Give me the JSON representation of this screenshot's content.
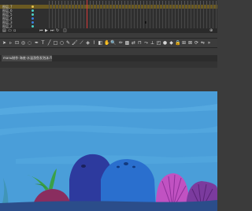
{
  "timeline": {
    "layers": [
      {
        "name": "图层_7",
        "highlight": true,
        "color": "#e6c24d"
      },
      {
        "name": "图层_6",
        "highlight": false,
        "color": "#4bd3c8"
      },
      {
        "name": "图层_5",
        "highlight": false,
        "color": "#4bd3c8"
      },
      {
        "name": "图层_4",
        "highlight": false,
        "color": "#3a7fe0"
      },
      {
        "name": "图层_3",
        "highlight": false,
        "color": "#3a7fe0"
      },
      {
        "name": "图层_2",
        "highlight": false,
        "color": "#4bd3c8"
      }
    ]
  },
  "document_tab": {
    "label": "manu制作·海底·水温游鱼发泡沫.fla"
  },
  "colors": {
    "ocean": "#4a9ed9",
    "rock_dark": "#2d3a9e",
    "rock_blue": "#2a6fce",
    "coral_pink": "#c152c2",
    "coral_purple": "#7b3b9e",
    "seabed": "#2b4d8a",
    "seaweed": "#3aa048"
  }
}
